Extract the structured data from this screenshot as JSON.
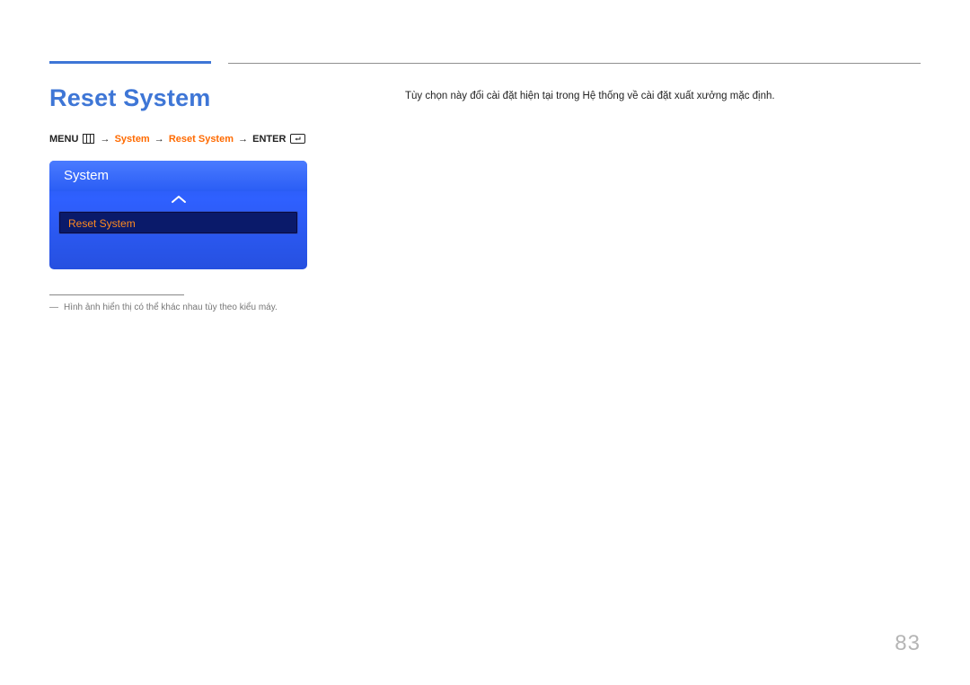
{
  "title": "Reset System",
  "path": {
    "menu": "MENU",
    "system": "System",
    "reset_system": "Reset System",
    "enter": "ENTER"
  },
  "menu": {
    "header": "System",
    "item": "Reset System"
  },
  "description": "Tùy chọn này đổi cài đặt hiện tại trong Hệ thống về cài đặt xuất xưởng mặc định.",
  "footnote": "Hình ảnh hiển thị có thể khác nhau tùy theo kiểu máy.",
  "page_number": "83"
}
